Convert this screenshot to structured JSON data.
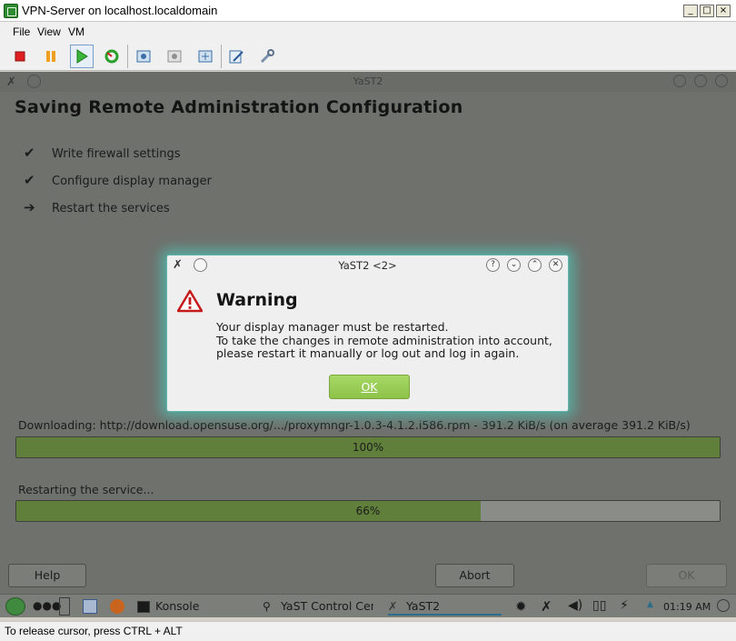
{
  "host": {
    "title": "VPN-Server on localhost.localdomain",
    "controls": {
      "minimize": "_",
      "maximize": "□",
      "close": "×"
    },
    "menu": [
      "File",
      "View",
      "VM"
    ],
    "toolbar": [
      "stop-icon",
      "pause-icon",
      "play-icon",
      "refresh-icon",
      "snapshot-icon",
      "snapshot-revert-icon",
      "snapshot-manager-icon",
      "edit-settings-icon",
      "tools-icon"
    ],
    "status": "To release cursor, press CTRL + ALT"
  },
  "yast": {
    "window_title": "YaST2",
    "heading": "Saving Remote Administration Configuration",
    "steps": [
      {
        "mark": "✔",
        "label": "Write firewall settings"
      },
      {
        "mark": "✔",
        "label": "Configure display manager"
      },
      {
        "mark": "➔",
        "label": "Restart the services"
      }
    ],
    "download_label": "Downloading: http://download.opensuse.org/.../proxymngr-1.0.3-4.1.2.i586.rpm - 391.2 KiB/s (on average 391.2 KiB/s)",
    "download_progress": {
      "value": 100,
      "text": "100%"
    },
    "service_label": "Restarting the service...",
    "service_progress": {
      "value": 66,
      "text": "66%"
    },
    "help_button": "Help",
    "abort_button": "Abort",
    "ok_button": "OK"
  },
  "dialog": {
    "title": "YaST2 <2>",
    "heading": "Warning",
    "line1": "Your display manager must be restarted.",
    "line2": "To take the changes in remote administration into account,",
    "line3": "please restart it manually or log out and log in again.",
    "ok_button": "OK",
    "controls": [
      "?",
      "⌄",
      "⌃",
      "✕"
    ]
  },
  "taskbar": {
    "tasks": [
      "Konsole",
      "YaST Control Cen",
      "YaST2"
    ],
    "time": "01:19 AM"
  }
}
